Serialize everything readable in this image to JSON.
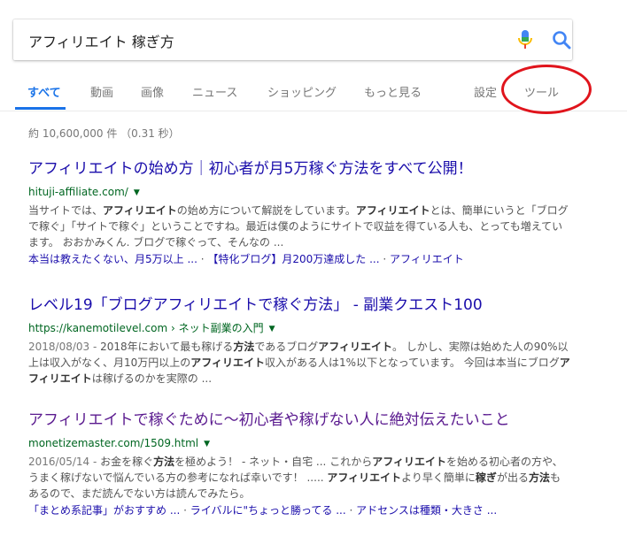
{
  "search": {
    "query": "アフィリエイト 稼ぎ方"
  },
  "tabs": [
    {
      "label": "すべて"
    },
    {
      "label": "動画"
    },
    {
      "label": "画像"
    },
    {
      "label": "ニュース"
    },
    {
      "label": "ショッピング"
    },
    {
      "label": "もっと見る"
    },
    {
      "label": "設定"
    },
    {
      "label": "ツール"
    }
  ],
  "stats": "約 10,600,000 件 （0.31 秒）",
  "results": [
    {
      "title": "アフィリエイトの始め方｜初心者が月5万稼ぐ方法をすべて公開！",
      "url": "hituji-affiliate.com/",
      "snippet": [
        {
          "t": "当サイトでは、"
        },
        {
          "t": "アフィリエイト",
          "b": true
        },
        {
          "t": "の始め方について解説をしています。"
        },
        {
          "t": "アフィリエイト",
          "b": true
        },
        {
          "t": "とは、簡単にいうと「ブログで稼ぐ」「サイトで稼ぐ」ということですね。最近は僕のようにサイトで収益を得ている人も、とっても増えています。 おおかみくん. ブログで稼ぐって、そんなの ..."
        }
      ],
      "sitelinks": [
        "本当は教えたくない、月5万以上 ...",
        "【特化ブログ】月200万達成した ...",
        "アフィリエイト"
      ]
    },
    {
      "title": "レベル19「ブログアフィリエイトで稼ぐ方法」 - 副業クエスト100",
      "url": "https://kanemotilevel.com › ネット副業の入門",
      "snippet": [
        {
          "t": "2018/08/03 - ",
          "date": true
        },
        {
          "t": "2018年において最も稼げる"
        },
        {
          "t": "方法",
          "b": true
        },
        {
          "t": "であるブログ"
        },
        {
          "t": "アフィリエイト",
          "b": true
        },
        {
          "t": "。 しかし、実際は始めた人の90%以上は収入がなく、月10万円以上の"
        },
        {
          "t": "アフィリエイト",
          "b": true
        },
        {
          "t": "収入がある人は1%以下となっています。 今回は本当にブログ"
        },
        {
          "t": "アフィリエイト",
          "b": true
        },
        {
          "t": "は稼げるのかを実際の ..."
        }
      ],
      "sitelinks": []
    },
    {
      "title": "アフィリエイトで稼ぐために～初心者や稼げない人に絶対伝えたいこと",
      "url": "monetizemaster.com/1509.html",
      "snippet": [
        {
          "t": "2016/05/14 - ",
          "date": true
        },
        {
          "t": "お金を稼ぐ"
        },
        {
          "t": "方法",
          "b": true
        },
        {
          "t": "を極めよう！ - ネット・自宅 ... これから"
        },
        {
          "t": "アフィリエイト",
          "b": true
        },
        {
          "t": "を始める初心者の方や、うまく稼げないで悩んでいる方の参考になれば幸いです！ ..... "
        },
        {
          "t": "アフィリエイト",
          "b": true
        },
        {
          "t": "より早く簡単に"
        },
        {
          "t": "稼ぎ",
          "b": true
        },
        {
          "t": "が出る"
        },
        {
          "t": "方法",
          "b": true
        },
        {
          "t": "もあるので、まだ読んでない方は読んでみたら。"
        }
      ],
      "sitelinks": [
        "「まとめ系記事」がおすすめ ...",
        "ライバルに\"ちょっと勝ってる ...",
        "アドセンスは種類・大きさ ..."
      ]
    }
  ],
  "colors": {
    "link": "#1a0dab",
    "visited": "#5a1a8f",
    "url": "#006621",
    "accent": "#1a73e8",
    "annotation": "#e0141c"
  },
  "icons": {
    "mic": "microphone-icon",
    "search": "search-icon"
  }
}
